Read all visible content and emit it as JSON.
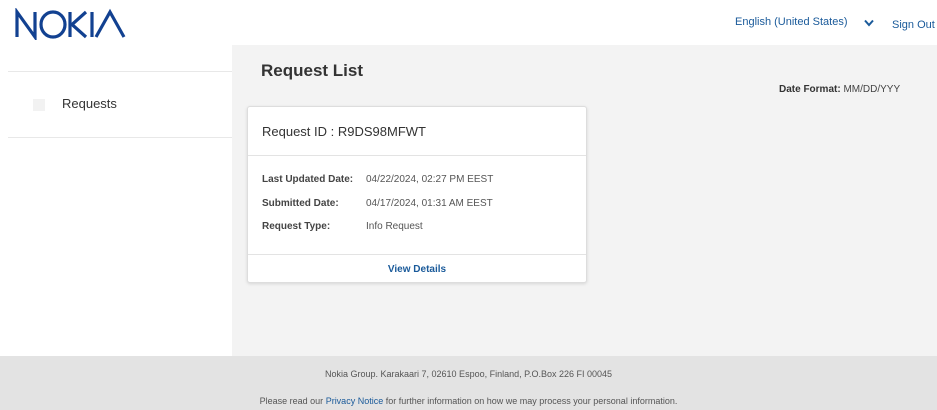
{
  "header": {
    "logo_text": "NOKIA",
    "language": "English (United States)",
    "signout": "Sign Out",
    "colors": {
      "brand": "#124191",
      "link": "#1a5a9a"
    }
  },
  "sidebar": {
    "items": [
      {
        "label": "Requests",
        "icon": "requests-icon"
      }
    ]
  },
  "main": {
    "title": "Request List",
    "date_format_label": "Date Format:",
    "date_format_value": "MM/DD/YYY",
    "request": {
      "title": "Request ID : R9DS98MFWT",
      "fields": [
        {
          "label": "Last Updated Date:",
          "value": "04/22/2024, 02:27 PM EEST"
        },
        {
          "label": "Submitted Date:",
          "value": "04/17/2024, 01:31 AM EEST"
        },
        {
          "label": "Request Type:",
          "value": "Info Request"
        }
      ],
      "view_details": "View Details"
    }
  },
  "footer": {
    "address": "Nokia Group. Karakaari 7, 02610 Espoo, Finland, P.O.Box 226 FI 00045",
    "privacy_prefix": "Please read our ",
    "privacy_link": "Privacy Notice",
    "privacy_suffix": " for further information on how we may process your personal information."
  }
}
